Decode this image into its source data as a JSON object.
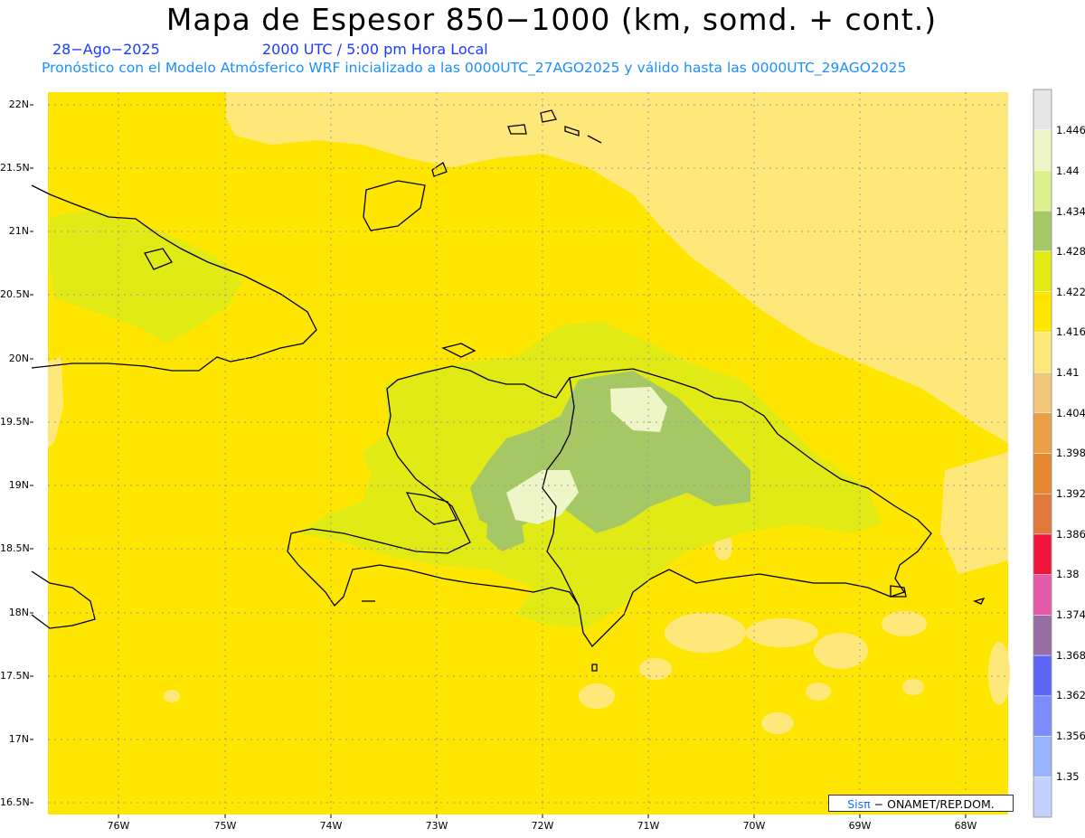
{
  "header": {
    "title": "Mapa de Espesor 850−1000 (km, somd. + cont.)",
    "date": "28−Ago−2025",
    "time": "2000 UTC / 5:00 pm Hora Local",
    "forecast_info": "Pronóstico con el Modelo Atmósferico WRF inicializado a las 0000UTC_27AGO2025 y válido hasta las  0000UTC_29AGO2025"
  },
  "axes": {
    "lat_labels": [
      "22N",
      "21.5N",
      "21N",
      "20.5N",
      "20N",
      "19.5N",
      "19N",
      "18.5N",
      "18N",
      "17.5N",
      "17N",
      "16.5N"
    ],
    "lon_labels": [
      "76W",
      "75W",
      "74W",
      "73W",
      "72W",
      "71W",
      "70W",
      "69W",
      "68W"
    ]
  },
  "colorbar": {
    "labels": [
      "1.446",
      "1.44",
      "1.434",
      "1.428",
      "1.422",
      "1.416",
      "1.41",
      "1.404",
      "1.398",
      "1.392",
      "1.386",
      "1.38",
      "1.374",
      "1.368",
      "1.362",
      "1.356",
      "1.35"
    ],
    "colors": [
      "#e6e6e6",
      "#eef6c8",
      "#dcf08c",
      "#a6c864",
      "#e1ea14",
      "#ffe600",
      "#ffe87a",
      "#f2c878",
      "#eba046",
      "#e68732",
      "#e1783c",
      "#f0143c",
      "#e65aaa",
      "#966ea5",
      "#5a64f5",
      "#7d8cff",
      "#96b4ff",
      "#c3d2ff"
    ]
  },
  "legend_colors": {
    "base": "#ffe600",
    "light_yellow": "#ffe87a",
    "lime": "#e1ea14",
    "olive": "#a6c864",
    "pale": "#eef6c8"
  },
  "credit": {
    "brand": "Sisπ",
    "org": " − ONAMET/REP.DOM."
  }
}
